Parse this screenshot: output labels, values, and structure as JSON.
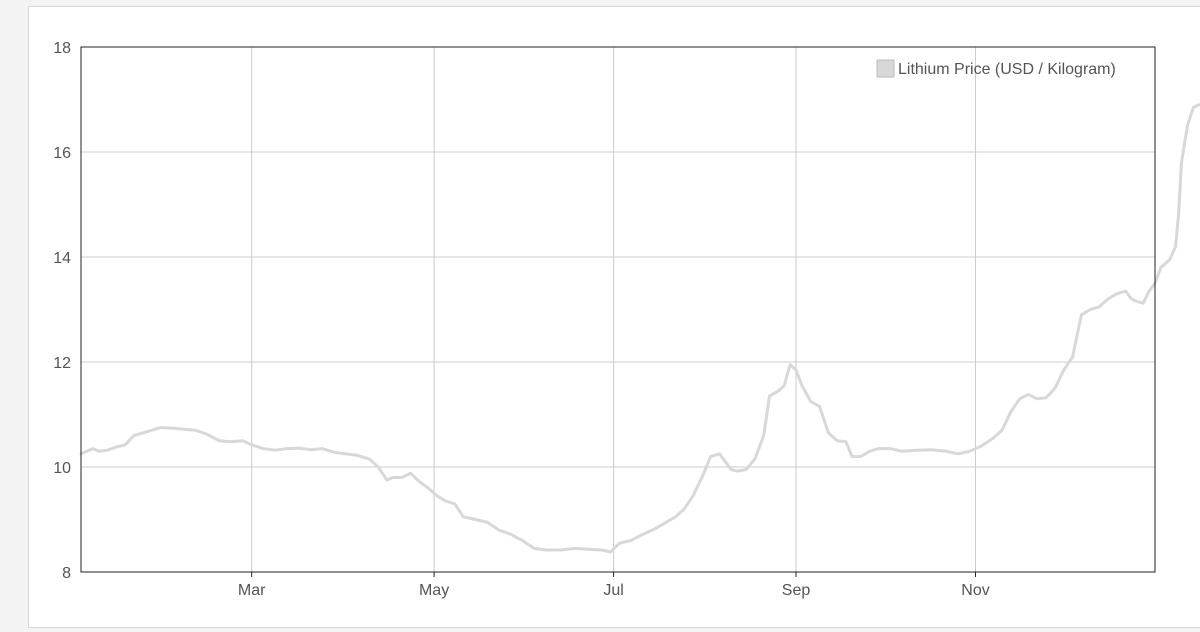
{
  "chart_data": {
    "type": "line",
    "title": "",
    "xlabel": "",
    "ylabel": "",
    "ylim": [
      8,
      18
    ],
    "yticks": [
      8,
      10,
      12,
      14,
      16,
      18
    ],
    "xlim": [
      1,
      366
    ],
    "xticks": [
      {
        "label": "Mar",
        "day": 59
      },
      {
        "label": "May",
        "day": 121
      },
      {
        "label": "Jul",
        "day": 182
      },
      {
        "label": "Sep",
        "day": 244
      },
      {
        "label": "Nov",
        "day": 305
      }
    ],
    "grid": true,
    "legend_position": "top-right",
    "series": [
      {
        "name": "Lithium Price (USD / Kilogram)",
        "color": "#d8d8d8",
        "points": [
          [
            1,
            10.25
          ],
          [
            3,
            10.3
          ],
          [
            5,
            10.35
          ],
          [
            7,
            10.3
          ],
          [
            10,
            10.32
          ],
          [
            13,
            10.38
          ],
          [
            16,
            10.42
          ],
          [
            19,
            10.6
          ],
          [
            22,
            10.65
          ],
          [
            25,
            10.7
          ],
          [
            28,
            10.75
          ],
          [
            32,
            10.74
          ],
          [
            36,
            10.72
          ],
          [
            40,
            10.7
          ],
          [
            44,
            10.62
          ],
          [
            48,
            10.5
          ],
          [
            52,
            10.48
          ],
          [
            56,
            10.5
          ],
          [
            59,
            10.42
          ],
          [
            63,
            10.35
          ],
          [
            67,
            10.32
          ],
          [
            71,
            10.35
          ],
          [
            75,
            10.36
          ],
          [
            79,
            10.33
          ],
          [
            83,
            10.35
          ],
          [
            87,
            10.28
          ],
          [
            91,
            10.25
          ],
          [
            95,
            10.22
          ],
          [
            99,
            10.15
          ],
          [
            102,
            10.0
          ],
          [
            105,
            9.75
          ],
          [
            107,
            9.8
          ],
          [
            110,
            9.8
          ],
          [
            113,
            9.88
          ],
          [
            116,
            9.72
          ],
          [
            119,
            9.6
          ],
          [
            122,
            9.45
          ],
          [
            125,
            9.35
          ],
          [
            128,
            9.3
          ],
          [
            131,
            9.05
          ],
          [
            135,
            9.0
          ],
          [
            139,
            8.95
          ],
          [
            143,
            8.8
          ],
          [
            147,
            8.72
          ],
          [
            151,
            8.6
          ],
          [
            155,
            8.45
          ],
          [
            159,
            8.42
          ],
          [
            164,
            8.42
          ],
          [
            169,
            8.45
          ],
          [
            174,
            8.43
          ],
          [
            178,
            8.42
          ],
          [
            181,
            8.38
          ],
          [
            184,
            8.55
          ],
          [
            188,
            8.6
          ],
          [
            192,
            8.72
          ],
          [
            196,
            8.82
          ],
          [
            200,
            8.95
          ],
          [
            203,
            9.05
          ],
          [
            206,
            9.2
          ],
          [
            209,
            9.45
          ],
          [
            212,
            9.8
          ],
          [
            215,
            10.2
          ],
          [
            218,
            10.25
          ],
          [
            220,
            10.1
          ],
          [
            222,
            9.95
          ],
          [
            224,
            9.92
          ],
          [
            227,
            9.95
          ],
          [
            230,
            10.15
          ],
          [
            233,
            10.6
          ],
          [
            235,
            11.35
          ],
          [
            238,
            11.45
          ],
          [
            240,
            11.55
          ],
          [
            242,
            11.95
          ],
          [
            244,
            11.85
          ],
          [
            246,
            11.55
          ],
          [
            249,
            11.25
          ],
          [
            252,
            11.15
          ],
          [
            255,
            10.65
          ],
          [
            258,
            10.5
          ],
          [
            261,
            10.48
          ],
          [
            263,
            10.2
          ],
          [
            266,
            10.2
          ],
          [
            269,
            10.3
          ],
          [
            272,
            10.35
          ],
          [
            276,
            10.35
          ],
          [
            280,
            10.3
          ],
          [
            285,
            10.32
          ],
          [
            290,
            10.33
          ],
          [
            295,
            10.3
          ],
          [
            299,
            10.25
          ],
          [
            303,
            10.3
          ],
          [
            307,
            10.4
          ],
          [
            311,
            10.55
          ],
          [
            314,
            10.7
          ],
          [
            317,
            11.05
          ],
          [
            320,
            11.3
          ],
          [
            323,
            11.38
          ],
          [
            326,
            11.3
          ],
          [
            329,
            11.32
          ],
          [
            332,
            11.5
          ],
          [
            335,
            11.85
          ],
          [
            338,
            12.1
          ],
          [
            341,
            12.9
          ],
          [
            344,
            13.0
          ],
          [
            347,
            13.05
          ],
          [
            350,
            13.2
          ],
          [
            353,
            13.3
          ],
          [
            356,
            13.35
          ],
          [
            358,
            13.2
          ],
          [
            360,
            13.15
          ],
          [
            362,
            13.12
          ],
          [
            364,
            13.35
          ],
          [
            366,
            13.5
          ],
          [
            368,
            13.8
          ],
          [
            371,
            13.95
          ],
          [
            373,
            14.2
          ],
          [
            374,
            14.8
          ],
          [
            375,
            15.8
          ],
          [
            377,
            16.5
          ],
          [
            379,
            16.85
          ],
          [
            381,
            16.9
          ]
        ]
      }
    ]
  }
}
